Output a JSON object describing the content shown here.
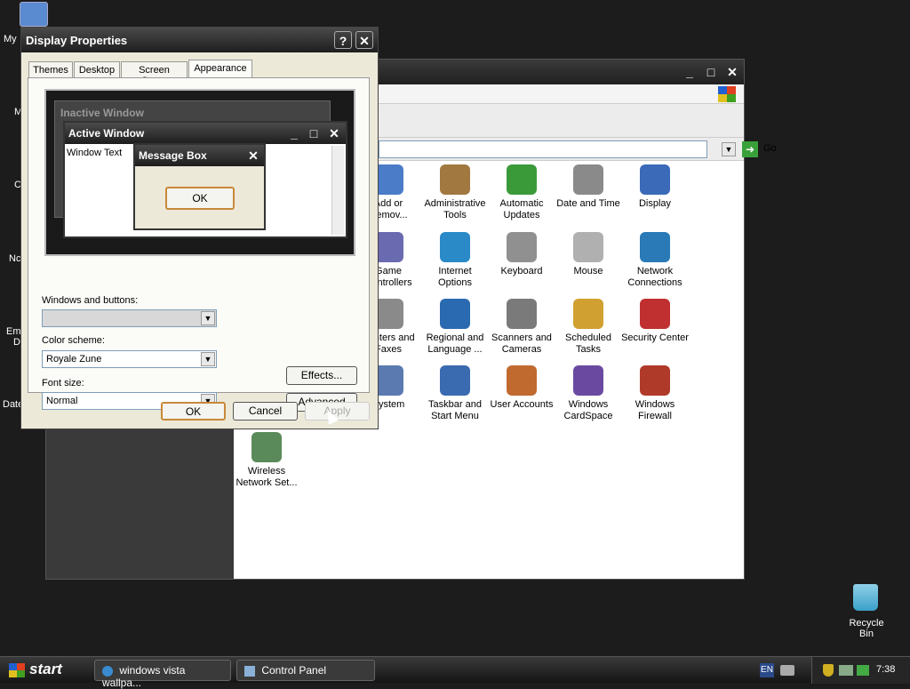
{
  "desktop": {
    "icons": [
      {
        "label": "My",
        "icon": "my-computer-icon"
      },
      {
        "label": "Recycle Bin",
        "icon": "recycle-bin-icon"
      }
    ],
    "partial_labels": [
      "M",
      "C",
      "Nc",
      "Em",
      "D",
      "Date"
    ]
  },
  "control_panel": {
    "go_label": "Go",
    "items": [
      {
        "label": "Add or Remov...",
        "icon": "add-remove-programs-icon",
        "color": "#4a7cc8"
      },
      {
        "label": "Administrative Tools",
        "icon": "administrative-tools-icon",
        "color": "#a07840"
      },
      {
        "label": "Automatic Updates",
        "icon": "automatic-updates-icon",
        "color": "#3a9a3a"
      },
      {
        "label": "Date and Time",
        "icon": "date-time-icon",
        "color": "#8a8a8a"
      },
      {
        "label": "Display",
        "icon": "display-icon",
        "color": "#3a6ab8"
      },
      {
        "label": "Game Controllers",
        "icon": "game-controllers-icon",
        "color": "#6a6ab0"
      },
      {
        "label": "Internet Options",
        "icon": "internet-options-icon",
        "color": "#2a8ac8"
      },
      {
        "label": "Keyboard",
        "icon": "keyboard-icon",
        "color": "#909090"
      },
      {
        "label": "Mouse",
        "icon": "mouse-icon",
        "color": "#b0b0b0"
      },
      {
        "label": "Network Connections",
        "icon": "network-connections-icon",
        "color": "#2a7ab8"
      },
      {
        "label": "Printers and Faxes",
        "icon": "printers-faxes-icon",
        "color": "#8a8a8a"
      },
      {
        "label": "Regional and Language ...",
        "icon": "regional-language-icon",
        "color": "#2a6ab0"
      },
      {
        "label": "Scanners and Cameras",
        "icon": "scanners-cameras-icon",
        "color": "#7a7a7a"
      },
      {
        "label": "Scheduled Tasks",
        "icon": "scheduled-tasks-icon",
        "color": "#d0a030"
      },
      {
        "label": "Security Center",
        "icon": "security-center-icon",
        "color": "#c03030"
      },
      {
        "label": "System",
        "icon": "system-icon",
        "color": "#5a7ab0"
      },
      {
        "label": "Taskbar and Start Menu",
        "icon": "taskbar-start-menu-icon",
        "color": "#3a6ab0"
      },
      {
        "label": "User Accounts",
        "icon": "user-accounts-icon",
        "color": "#c06a30"
      },
      {
        "label": "Windows CardSpace",
        "icon": "cardspace-icon",
        "color": "#6a4aa0"
      },
      {
        "label": "Windows Firewall",
        "icon": "windows-firewall-icon",
        "color": "#b03a2a"
      },
      {
        "label": "Wireless Network Set...",
        "icon": "wireless-network-icon",
        "color": "#5a8a5a"
      }
    ]
  },
  "dialog": {
    "title": "Display Properties",
    "tabs": [
      "Themes",
      "Desktop",
      "Screen Saver",
      "Appearance"
    ],
    "active_tab": "Appearance",
    "preview": {
      "inactive_title": "Inactive Window",
      "active_title": "Active Window",
      "window_text": "Window Text",
      "msgbox_title": "Message Box",
      "msgbox_ok": "OK"
    },
    "windows_buttons_label": "Windows and buttons:",
    "windows_buttons_value": "",
    "color_scheme_label": "Color scheme:",
    "color_scheme_value": "Royale Zune",
    "font_size_label": "Font size:",
    "font_size_value": "Normal",
    "effects_label": "Effects...",
    "advanced_label": "Advanced",
    "ok_label": "OK",
    "cancel_label": "Cancel",
    "apply_label": "Apply"
  },
  "taskbar": {
    "start_label": "start",
    "tasks": [
      "windows vista wallpa...",
      "Control Panel"
    ],
    "language": "EN",
    "clock": "7:38"
  }
}
